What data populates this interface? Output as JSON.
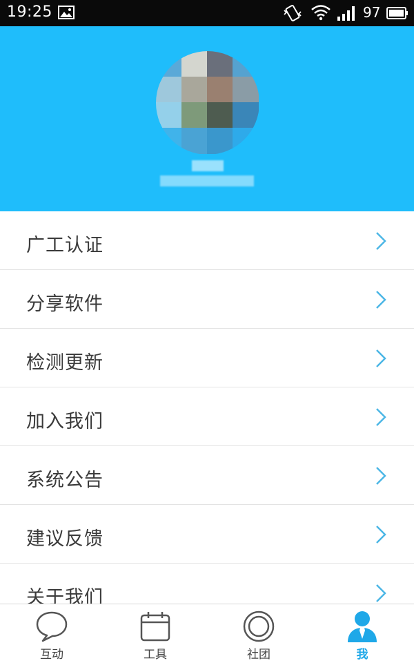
{
  "status_bar": {
    "time": "19:25",
    "battery": "97",
    "icons": [
      "image-icon",
      "vibrate-icon",
      "wifi-icon",
      "signal-icon",
      "battery-icon"
    ]
  },
  "colors": {
    "header_bg": "#1fbdfb",
    "accent": "#1fa8e8",
    "chevron": "#4bb6e6",
    "text": "#3a3a3a"
  },
  "menu": {
    "items": [
      {
        "label": "广工认证",
        "icon": "chevron-right-icon"
      },
      {
        "label": "分享软件",
        "icon": "chevron-right-icon"
      },
      {
        "label": "检测更新",
        "icon": "chevron-right-icon"
      },
      {
        "label": "加入我们",
        "icon": "chevron-right-icon"
      },
      {
        "label": "系统公告",
        "icon": "chevron-right-icon"
      },
      {
        "label": "建议反馈",
        "icon": "chevron-right-icon"
      },
      {
        "label": "关于我们",
        "icon": "chevron-right-icon"
      }
    ]
  },
  "bottom_nav": {
    "tabs": [
      {
        "label": "互动",
        "icon": "chat-bubble-icon",
        "active": false
      },
      {
        "label": "工具",
        "icon": "calendar-icon",
        "active": false
      },
      {
        "label": "社团",
        "icon": "ring-icon",
        "active": false
      },
      {
        "label": "我",
        "icon": "person-icon",
        "active": true
      }
    ]
  }
}
